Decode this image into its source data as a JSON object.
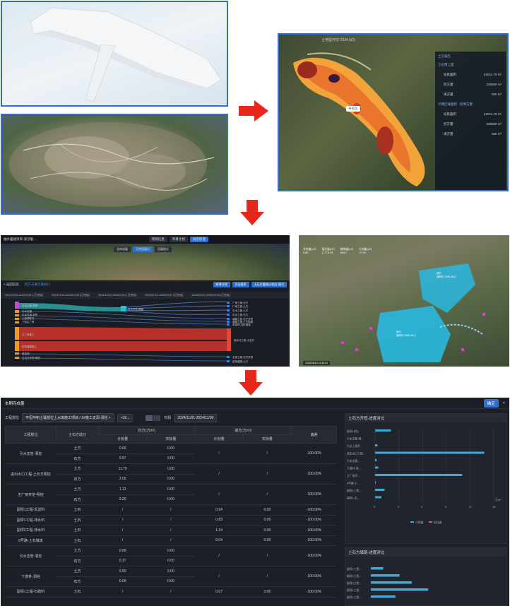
{
  "panel3": {
    "title": "土地型开挖-2024.9(2)",
    "side_title": "土方报告",
    "section1": "土石量上面",
    "rows1": [
      {
        "label": "投影面积",
        "value": "24041.79 m²"
      },
      {
        "label": "挖方量",
        "value": "236659 m³"
      },
      {
        "label": "填方量",
        "value": "590 m³"
      }
    ],
    "section2": "计算区域面积 · 挖填方量",
    "rows2": [
      {
        "label": "投影面积",
        "value": "24041.79 m²"
      },
      {
        "label": "挖方量",
        "value": "236659 m³"
      },
      {
        "label": "填方量",
        "value": "590 m³"
      }
    ],
    "badge": "开挖区"
  },
  "panel4": {
    "app_title": "抽水蓄能项目-演示版...",
    "top_tabs": [
      "项目信息",
      "项目计划",
      "进度管理"
    ],
    "sub_tabs": [
      "总体进展",
      "开挖回填计",
      "回填统计"
    ],
    "back": "< 返回首页",
    "tab": "挖方与填方量统计",
    "buttons": [
      "新增计划",
      "导出报表",
      "土石方量统计/挖方-填方"
    ],
    "dates": [
      "2024/10/01-2024/10/31 (已完成)",
      "2024/11/01-2024/11/30 (已完成)",
      "2024/12/01-2024/12/31 (已完成)",
      "2025/01/01-2025/01/31 (已完成)",
      "2025/02/01-2025/02/28 (已完成)"
    ],
    "left_labels": [
      "引水支管-洞挖",
      "引水支管",
      "引水支管-洞挖",
      "上游调压井",
      "下游主厂房",
      "主厂房施工",
      "进场道路施工",
      "弃渣场",
      "主石方开挖-明挖",
      "进水塔施工",
      "主体工程-石方",
      "支洞工程-石方"
    ],
    "mid_label": "石方开挖-爆破",
    "right_labels": [
      "厂房工程-石方",
      "厂房工程-土方",
      "引水工程-土方",
      "引水工程-石方",
      "道路工程-石方开挖",
      "道路工程-土方回填",
      "弃渣场工程-堆渣",
      "进水口工程-土石方",
      "主体工程-石方开挖",
      "进场道路-土方",
      "交通洞工程",
      "上库工程-土方",
      "下库工程-石方",
      "库盆开挖(石方)",
      "施工支洞-土方",
      "施工支洞-石方"
    ]
  },
  "panel5": {
    "stats": [
      {
        "label": "开挖量(m³)",
        "value": "5.80"
      },
      {
        "label": "填方量(m³)",
        "value": "17778.76"
      },
      {
        "label": "剩余量(m³)",
        "value": "665.7"
      },
      {
        "label": "计划量(m³)",
        "value": "17.06"
      }
    ],
    "area1": "填方",
    "area1_sub": "面积约 1295.38㎡",
    "area2": "填方",
    "area2_sub": "面积约 2365.40㎡",
    "footer": "2025/08/19 13:40:52"
  },
  "panel6": {
    "title": "本期完成量",
    "confirm": "确定",
    "close": "×",
    "filter_label": "工程部位",
    "filter_value": "平坦冲积土壤部位上水库施工项目 / 1#施工支洞-洞挖 ×",
    "filter_more": "+16...",
    "time_label": "时段",
    "time_value": "2024/11/01-2024/11/30",
    "headers": {
      "part": "工程部位",
      "component": "土石方成分",
      "excavation": "挖方(万m³)",
      "fill": "填方(万m³)",
      "planned": "计划量",
      "actual": "实际量",
      "deviation": "偏差"
    },
    "rows": [
      {
        "part": "引水支管-洞挖",
        "sub": [
          {
            "c": "土方",
            "p": "0.00",
            "a": "0.00"
          },
          {
            "c": "石方",
            "p": "0.07",
            "a": "0.00"
          }
        ],
        "fp": "/",
        "fa": "/",
        "d": "-100.00%"
      },
      {
        "part": "进出水口工程-土石方明挖",
        "sub": [
          {
            "c": "土方",
            "p": "11.79",
            "a": "0.00"
          },
          {
            "c": "石方",
            "p": "2.00",
            "a": "0.00"
          }
        ],
        "fp": "/",
        "fa": "/",
        "d": "-100.00%"
      },
      {
        "part": "主厂房开挖-明挖",
        "sub": [
          {
            "c": "土方",
            "p": "1.13",
            "a": "0.00"
          },
          {
            "c": "石方",
            "p": "0.20",
            "a": "0.00"
          }
        ],
        "fp": "/",
        "fa": "/",
        "d": "-100.00%"
      },
      {
        "part": "副坝1工程-反滤料",
        "sub": [
          {
            "c": "土石",
            "p": "/",
            "a": "/"
          }
        ],
        "fp": "0.94",
        "fa": "0.00",
        "d": "-100.00%"
      },
      {
        "part": "副坝1工程-排水料",
        "sub": [
          {
            "c": "土石",
            "p": "/",
            "a": "/"
          }
        ],
        "fp": "0.83",
        "fa": "0.00",
        "d": "-100.00%"
      },
      {
        "part": "副坝2工程-排水料",
        "sub": [
          {
            "c": "土石",
            "p": "/",
            "a": "/"
          }
        ],
        "fp": "1.24",
        "fa": "0.00",
        "d": "-100.00%"
      },
      {
        "part": "8号路-土石填筑",
        "sub": [
          {
            "c": "土石",
            "p": "/",
            "a": "/"
          }
        ],
        "fp": "0.04",
        "fa": "0.00",
        "d": "-100.00%"
      },
      {
        "part": "引水支管-洞挖",
        "sub": [
          {
            "c": "土方",
            "p": "0.00",
            "a": "0.00"
          },
          {
            "c": "石方",
            "p": "0.37",
            "a": "0.00"
          }
        ],
        "fp": "/",
        "fa": "/",
        "d": "-100.00%"
      },
      {
        "part": "下游井-洞挖",
        "sub": [
          {
            "c": "土方",
            "p": "0.00",
            "a": "0.00"
          },
          {
            "c": "石方",
            "p": "0.09",
            "a": "0.00"
          }
        ],
        "fp": "/",
        "fa": "/",
        "d": "-100.00%"
      },
      {
        "part": "副坝1工程-石碴料",
        "sub": [
          {
            "c": "土石",
            "p": "/",
            "a": "/"
          }
        ],
        "fp": "0.57",
        "fa": "0.00",
        "d": "-100.00%"
      }
    ]
  },
  "chart_data": [
    {
      "type": "bar",
      "title": "土石方开挖-进度对比",
      "orientation": "horizontal",
      "categories": [
        "副坝1(挖)...",
        "引水支管-洞...",
        "引水上游开...",
        "进出水口工程...",
        "引水支管-...",
        "下游井-洞...",
        "主厂房开...",
        "8号路-土...",
        "副坝1工程...",
        "副坝1-石..."
      ],
      "series": [
        {
          "name": "计划量",
          "values": [
            2.0,
            0.0,
            0.3,
            13.8,
            0.2,
            0.4,
            11.0,
            0.1,
            1.2,
            0.8
          ]
        },
        {
          "name": "实际量",
          "values": [
            0,
            0,
            0,
            0,
            0,
            0,
            0,
            0,
            0,
            0
          ]
        }
      ],
      "xlim": [
        0,
        15
      ],
      "xticks": [
        "0",
        "3",
        "6",
        "9",
        "12",
        "15"
      ],
      "unit": "万m³",
      "colors": [
        "#3fa9d8",
        "#e05a5a"
      ]
    },
    {
      "type": "bar",
      "title": "土石方填筑-进度对比",
      "orientation": "horizontal",
      "categories": [
        "副坝1工程...",
        "副坝1工程...",
        "副坝2工程...",
        "副坝1工程...",
        "副坝1工程..."
      ],
      "series": [
        {
          "name": "计划量",
          "values": [
            0.3,
            0.7,
            1.0,
            1.4,
            0.6
          ]
        }
      ],
      "colors": [
        "#3fa9d8"
      ]
    }
  ]
}
